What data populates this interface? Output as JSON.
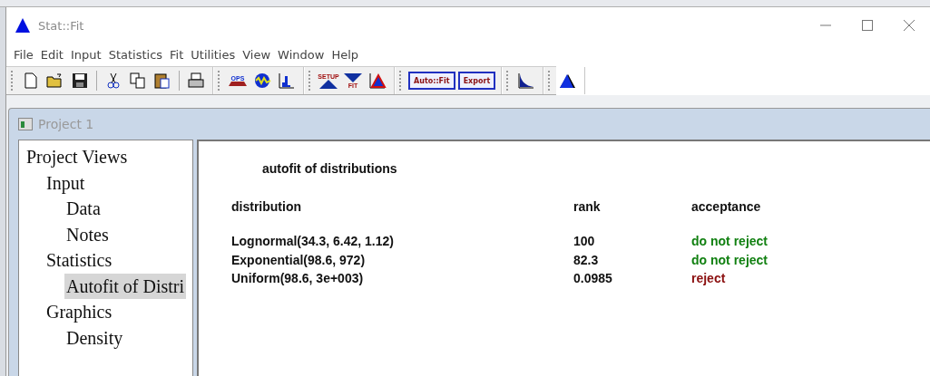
{
  "window": {
    "title": "Stat::Fit"
  },
  "menu": [
    {
      "label": "File"
    },
    {
      "label": "Edit"
    },
    {
      "label": "Input"
    },
    {
      "label": "Statistics"
    },
    {
      "label": "Fit"
    },
    {
      "label": "Utilities"
    },
    {
      "label": "View"
    },
    {
      "label": "Window"
    },
    {
      "label": "Help"
    }
  ],
  "toolbar": [
    [
      {
        "kind": "new"
      },
      {
        "kind": "open"
      },
      {
        "kind": "save"
      },
      {
        "kind": "sep"
      },
      {
        "kind": "cut"
      },
      {
        "kind": "copy"
      },
      {
        "kind": "paste"
      },
      {
        "kind": "sep"
      },
      {
        "kind": "print"
      }
    ],
    [
      {
        "kind": "ops",
        "label": "OPS"
      },
      {
        "kind": "wave"
      },
      {
        "kind": "histogram"
      }
    ],
    [
      {
        "kind": "setup",
        "label": "SETUP"
      },
      {
        "kind": "fit",
        "label": "FIT"
      },
      {
        "kind": "triangle"
      }
    ],
    [
      {
        "kind": "textbutton",
        "label": "Auto::Fit"
      },
      {
        "kind": "textbutton",
        "label": "Export"
      }
    ],
    [
      {
        "kind": "curve"
      }
    ],
    [
      {
        "kind": "peak"
      }
    ]
  ],
  "child_window": {
    "title": "Project 1"
  },
  "tree": {
    "label": "Project Views",
    "selected": false,
    "children": [
      {
        "label": "Input",
        "selected": false,
        "children": [
          {
            "label": "Data",
            "selected": false
          },
          {
            "label": "Notes",
            "selected": false
          }
        ]
      },
      {
        "label": "Statistics",
        "selected": false,
        "children": [
          {
            "label": "Autofit of Distri",
            "selected": true
          }
        ]
      },
      {
        "label": "Graphics",
        "selected": false,
        "children": [
          {
            "label": "Density",
            "selected": false
          }
        ]
      }
    ]
  },
  "report": {
    "title": "autofit of distributions",
    "columns": [
      "distribution",
      "rank",
      "acceptance"
    ],
    "rows": [
      {
        "distribution": "Lognormal(34.3, 6.42, 1.12)",
        "rank": "100",
        "acceptance": "do not reject",
        "color": "#118011"
      },
      {
        "distribution": "Exponential(98.6, 972)",
        "rank": "82.3",
        "acceptance": "do not reject",
        "color": "#118011"
      },
      {
        "distribution": "Uniform(98.6, 3e+003)",
        "rank": "0.0985",
        "acceptance": "reject",
        "color": "#8b1010"
      }
    ]
  }
}
